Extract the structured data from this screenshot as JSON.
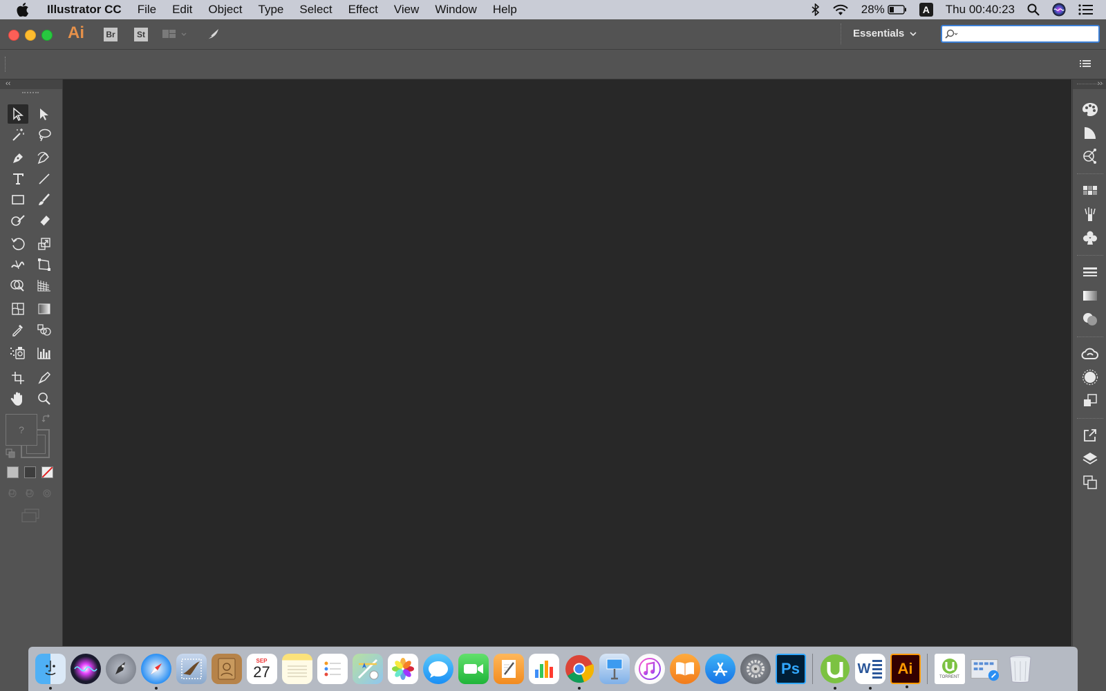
{
  "menubar": {
    "app_name": "Illustrator CC",
    "menus": [
      "File",
      "Edit",
      "Object",
      "Type",
      "Select",
      "Effect",
      "View",
      "Window",
      "Help"
    ],
    "battery": "28%",
    "input_method": "A",
    "clock": "Thu 00:40:23"
  },
  "appbar": {
    "logo": "Ai",
    "bridge_label": "Br",
    "stock_label": "St",
    "workspace": "Essentials",
    "search_value": ""
  },
  "toolbar": {
    "fill_stroke_unknown": "?"
  },
  "dock": {
    "calendar_month": "SEP",
    "calendar_day": "27",
    "photoshop_label": "Ps",
    "word_label": "W",
    "illustrator_label": "Ai",
    "torrent_label": "TORRENT"
  },
  "colors": {
    "menubar_bg": "#c9ccd6",
    "panel_bg": "#535353",
    "canvas_bg": "#282828",
    "ai_orange": "#e6914a",
    "search_focus": "#3b7fd6"
  }
}
